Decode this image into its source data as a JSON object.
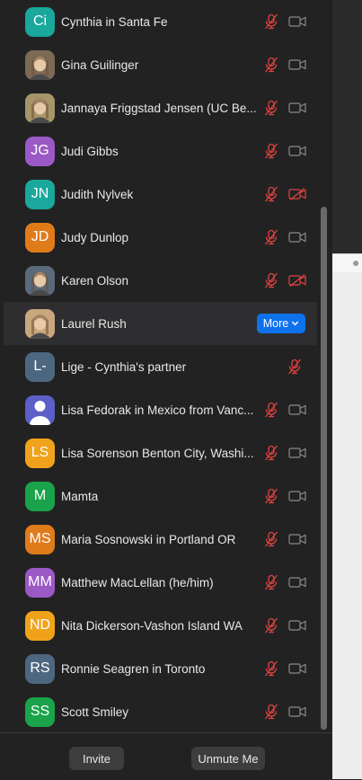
{
  "participants": [
    {
      "name": "Cynthia in Santa Fe",
      "initials": "Ci",
      "color": "#1aa79c",
      "mic": "muted",
      "video": "off"
    },
    {
      "name": "Gina Guilinger",
      "initials": "",
      "photo": true,
      "color": "#7d6a55",
      "mic": "muted",
      "video": "off"
    },
    {
      "name": "Jannaya Friggstad Jensen (UC Be...",
      "initials": "",
      "photo": true,
      "color": "#a7956a",
      "mic": "muted",
      "video": "off"
    },
    {
      "name": "Judi Gibbs",
      "initials": "JG",
      "color": "#9b59c6",
      "mic": "muted",
      "video": "off"
    },
    {
      "name": "Judith Nylvek",
      "initials": "JN",
      "color": "#1aa79c",
      "mic": "muted",
      "video": "stopped"
    },
    {
      "name": "Judy Dunlop",
      "initials": "JD",
      "color": "#e07b1a",
      "mic": "muted",
      "video": "off"
    },
    {
      "name": "Karen Olson",
      "initials": "",
      "photo": true,
      "color": "#5a6a7a",
      "mic": "muted",
      "video": "stopped"
    },
    {
      "name": "Laurel Rush",
      "initials": "",
      "photo": true,
      "color": "#c8a67e",
      "highlight": true,
      "more_label": "More"
    },
    {
      "name": "Lige - Cynthia's partner",
      "initials": "L-",
      "color": "#4d6780",
      "mic": "muted",
      "video": "none"
    },
    {
      "name": "Lisa Fedorak in Mexico from Vanc...",
      "initials": "",
      "generic": true,
      "color": "#5b5fc7",
      "mic": "muted",
      "video": "off"
    },
    {
      "name": "Lisa Sorenson Benton City, Washi...",
      "initials": "LS",
      "color": "#f0a31a",
      "mic": "muted",
      "video": "off"
    },
    {
      "name": "Mamta",
      "initials": "M",
      "color": "#1aa34a",
      "mic": "muted",
      "video": "off"
    },
    {
      "name": "Maria Sosnowski in Portland OR",
      "initials": "MS",
      "color": "#e07b1a",
      "mic": "muted",
      "video": "off"
    },
    {
      "name": "Matthew MacLellan (he/him)",
      "initials": "MM",
      "color": "#9b59c6",
      "mic": "muted",
      "video": "off"
    },
    {
      "name": "Nita Dickerson-Vashon Island WA",
      "initials": "ND",
      "color": "#f0a31a",
      "mic": "muted",
      "video": "off"
    },
    {
      "name": "Ronnie Seagren in Toronto",
      "initials": "RS",
      "color": "#4d6780",
      "mic": "muted",
      "video": "off"
    },
    {
      "name": "Scott Smiley",
      "initials": "SS",
      "color": "#1aa34a",
      "mic": "muted",
      "video": "off"
    }
  ],
  "footer": {
    "invite_label": "Invite",
    "unmute_label": "Unmute Me"
  },
  "colors": {
    "muted_red": "#e0433f",
    "icon_gray": "#8a8a8a",
    "accent_blue": "#0e72ed"
  }
}
